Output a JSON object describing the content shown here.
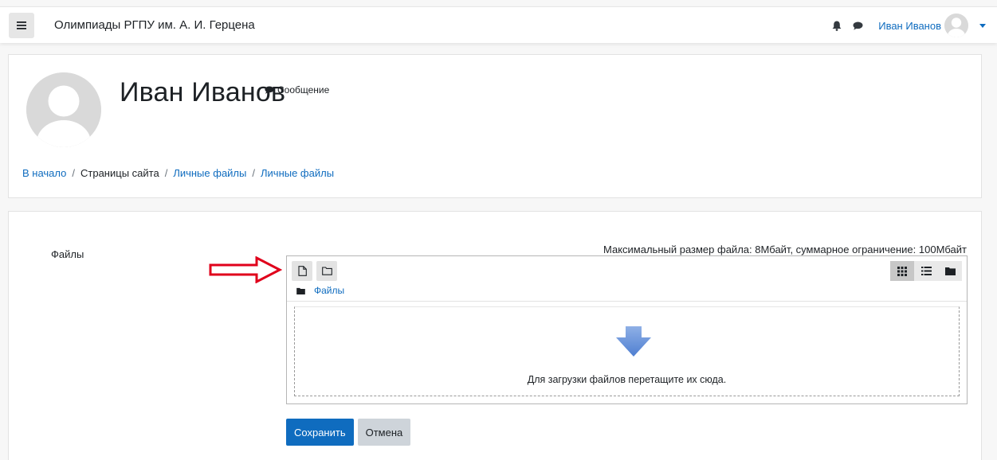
{
  "navbar": {
    "menu_icon": "hamburger-icon",
    "site_title": "Олимпиады РГПУ им. А. И. Герцена",
    "notifications_icon": "bell-icon",
    "messages_icon": "speech-bubble-icon",
    "user_name": "Иван Иванов"
  },
  "header": {
    "title": "Иван Иванов",
    "message_link": "Сообщение",
    "breadcrumb": {
      "home": "В начало",
      "site_pages": "Страницы сайта",
      "private_files_1": "Личные файлы",
      "private_files_2": "Личные файлы",
      "separator": "/"
    }
  },
  "form": {
    "files_label": "Файлы",
    "max_size_text": "Максимальный размер файла: 8Мбайт, суммарное ограничение: 100Мбайт",
    "toolbar": {
      "add_file_icon": "file-icon",
      "create_folder_icon": "folder-outline-icon",
      "view_icons_icon": "grid-icon",
      "view_list_icon": "list-icon",
      "view_tree_icon": "folder-icon"
    },
    "path_label": "Файлы",
    "drop_text": "Для загрузки файлов перетащите их сюда.",
    "save_label": "Сохранить",
    "cancel_label": "Отмена"
  },
  "colors": {
    "primary": "#0f6cbf",
    "secondary_button": "#ced4da",
    "annotation_arrow": "#e0001b"
  }
}
